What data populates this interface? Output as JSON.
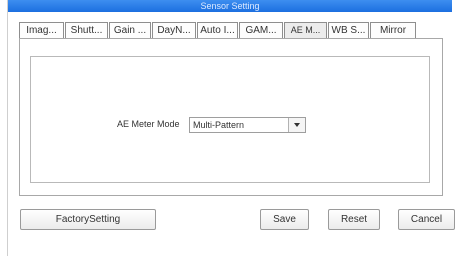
{
  "window": {
    "title": "Sensor Setting"
  },
  "tabs": [
    {
      "label": "Imag..."
    },
    {
      "label": "Shutt..."
    },
    {
      "label": "Gain ..."
    },
    {
      "label": "DayN..."
    },
    {
      "label": "Auto I..."
    },
    {
      "label": "GAM..."
    },
    {
      "label": "AE M...",
      "active": true
    },
    {
      "label": "WB S..."
    },
    {
      "label": "Mirror"
    }
  ],
  "ae_meter": {
    "label": "AE Meter Mode",
    "value": "Multi-Pattern"
  },
  "buttons": {
    "factory": "FactorySetting",
    "save": "Save",
    "reset": "Reset",
    "cancel": "Cancel"
  }
}
